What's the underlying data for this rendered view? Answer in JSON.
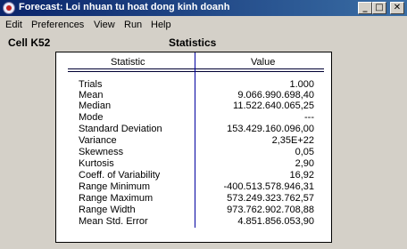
{
  "window": {
    "title": "Forecast: Loi nhuan tu hoat dong kinh doanh",
    "minimize_glyph": "_",
    "maximize_glyph": "□",
    "close_glyph": "✕"
  },
  "menu": {
    "items": [
      "Edit",
      "Preferences",
      "View",
      "Run",
      "Help"
    ]
  },
  "header": {
    "cell": "Cell K52",
    "title": "Statistics"
  },
  "table": {
    "col_statistic": "Statistic",
    "col_value": "Value",
    "rows": [
      {
        "label": "Trials",
        "value": "1.000"
      },
      {
        "label": "Mean",
        "value": "9.066.990.698,40"
      },
      {
        "label": "Median",
        "value": "11.522.640.065,25"
      },
      {
        "label": "Mode",
        "value": "---"
      },
      {
        "label": "Standard Deviation",
        "value": "153.429.160.096,00"
      },
      {
        "label": "Variance",
        "value": "2,35E+22"
      },
      {
        "label": "Skewness",
        "value": "0,05"
      },
      {
        "label": "Kurtosis",
        "value": "2,90"
      },
      {
        "label": "Coeff. of Variability",
        "value": "16,92"
      },
      {
        "label": "Range Minimum",
        "value": "-400.513.578.946,31"
      },
      {
        "label": "Range Maximum",
        "value": "573.249.323.762,57"
      },
      {
        "label": "Range Width",
        "value": "973.762.902.708,88"
      },
      {
        "label": "Mean Std. Error",
        "value": "4.851.856.053,90"
      }
    ]
  },
  "colors": {
    "titlebar_start": "#0a246a",
    "titlebar_end": "#3a6ea5",
    "window_bg": "#d4d0c8",
    "panel_bg": "#ffffff",
    "separator": "#0000a0"
  }
}
